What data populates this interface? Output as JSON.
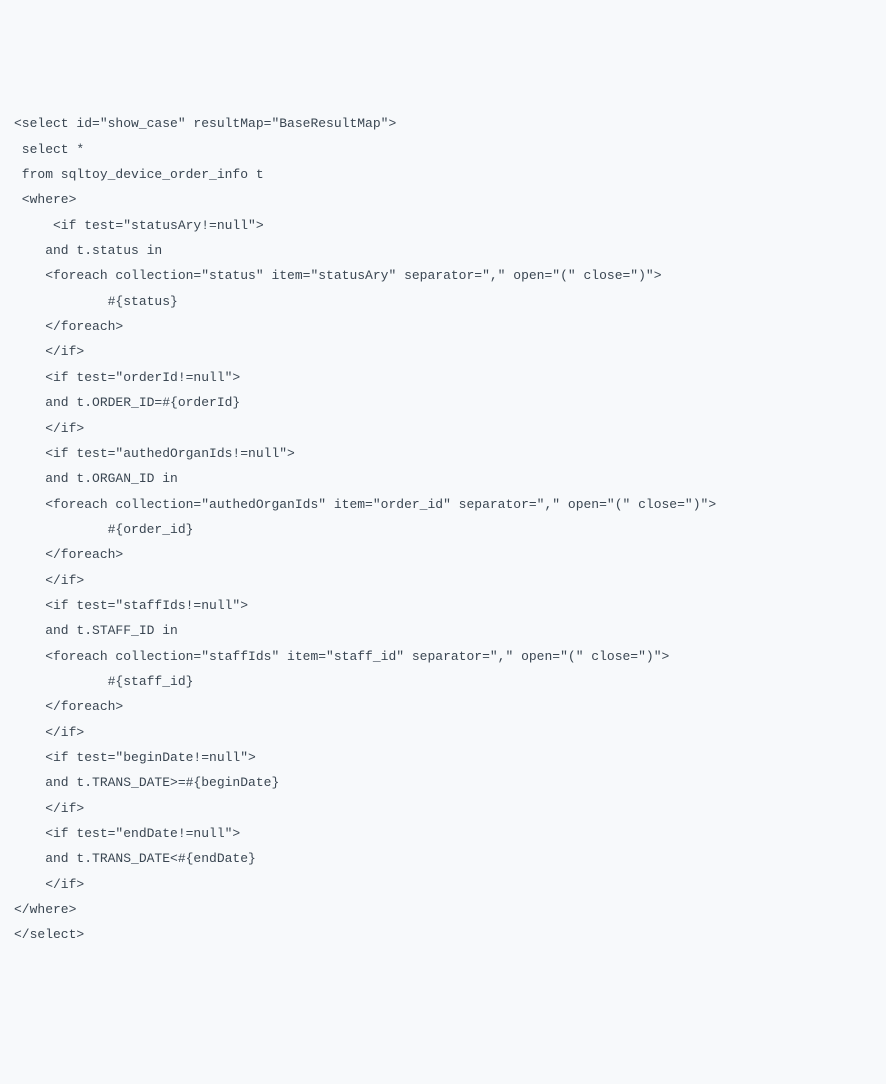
{
  "code": {
    "lines": [
      "<select id=\"show_case\" resultMap=\"BaseResultMap\">",
      " select *",
      " from sqltoy_device_order_info t",
      " <where>",
      "     <if test=\"statusAry!=null\">",
      "    and t.status in ",
      "    <foreach collection=\"status\" item=\"statusAry\" separator=\",\" open=\"(\" close=\")\">",
      "            #{status}  ",
      "    </foreach>",
      "    </if>",
      "    <if test=\"orderId!=null\">",
      "    and t.ORDER_ID=#{orderId}",
      "    </if>",
      "    <if test=\"authedOrganIds!=null\">",
      "    and t.ORGAN_ID in",
      "    <foreach collection=\"authedOrganIds\" item=\"order_id\" separator=\",\" open=\"(\" close=\")\">",
      "            #{order_id}  ",
      "    </foreach>",
      "    </if>",
      "    <if test=\"staffIds!=null\">",
      "    and t.STAFF_ID in",
      "    <foreach collection=\"staffIds\" item=\"staff_id\" separator=\",\" open=\"(\" close=\")\">",
      "            #{staff_id}  ",
      "    </foreach>",
      "    </if>",
      "    <if test=\"beginDate!=null\">",
      "    and t.TRANS_DATE>=#{beginDate}",
      "    </if>",
      "    <if test=\"endDate!=null\">",
      "    and t.TRANS_DATE<#{endDate}",
      "    </if>",
      "</where>",
      "</select>"
    ]
  }
}
